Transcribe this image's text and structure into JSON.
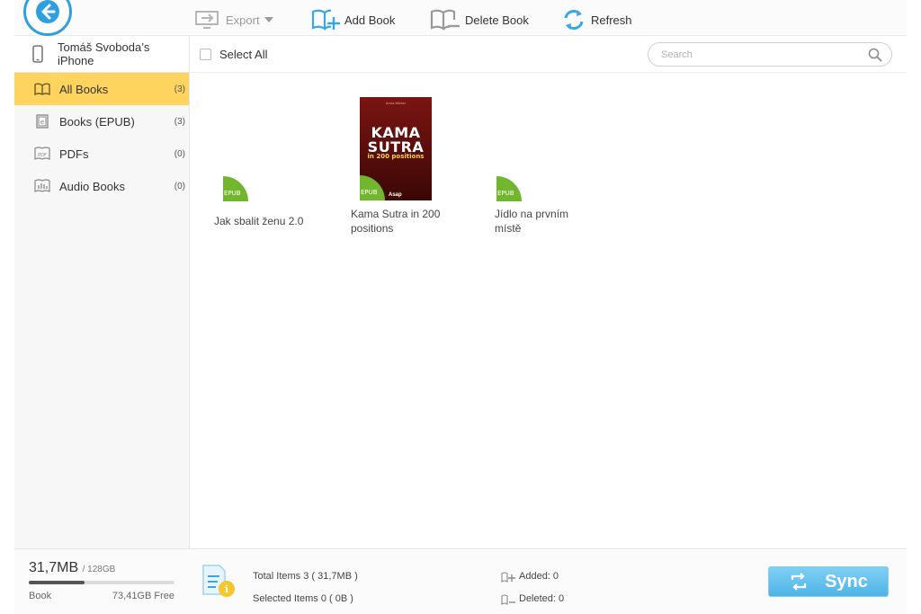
{
  "toolbar": {
    "export_label": "Export",
    "add_label": "Add Book",
    "delete_label": "Delete Book",
    "refresh_label": "Refresh"
  },
  "sidebar": {
    "device_name": "Tomáš Svoboda’s iPhone",
    "items": [
      {
        "label": "All Books",
        "count": "(3)",
        "icon": "book-open-icon",
        "active": true
      },
      {
        "label": "Books (EPUB)",
        "count": "(3)",
        "icon": "epub-book-icon",
        "active": false
      },
      {
        "label": "PDFs",
        "count": "(0)",
        "icon": "pdf-icon",
        "active": false
      },
      {
        "label": "Audio Books",
        "count": "(0)",
        "icon": "audio-book-icon",
        "active": false
      }
    ]
  },
  "subbar": {
    "select_all_label": "Select All",
    "search_placeholder": "Search"
  },
  "books": [
    {
      "title": "Jak sbalit ženu 2.0",
      "format": "EPUB"
    },
    {
      "title": "Kama Sutra in 200 positions",
      "format": "EPUB",
      "cover": {
        "header": "Anna Winter",
        "title_line1": "KAMA",
        "title_line2": "SUTRA",
        "subtitle": "in 200 positions",
        "publisher": "Asap"
      }
    },
    {
      "title": "Jídlo na prvním místě",
      "format": "EPUB"
    }
  ],
  "footer": {
    "used": "31,7MB",
    "total": "/ 128GB",
    "used_fraction": 0.38,
    "type_label": "Book",
    "free": "73,41GB Free",
    "total_items": "Total Items  3  ( 31,7MB )",
    "selected_items": "Selected Items  0  ( 0B )",
    "added": "Added: 0",
    "deleted": "Deleted: 0",
    "sync_label": "Sync"
  },
  "colors": {
    "accent_blue": "#2f9fe0",
    "active_yellow": "#fed35e",
    "epub_green": "#72b62f",
    "sync_blue": "#5bbbe9"
  }
}
